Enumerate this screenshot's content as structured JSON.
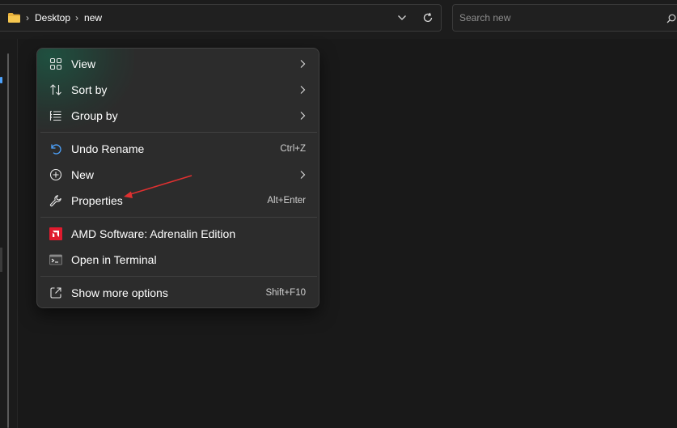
{
  "address_bar": {
    "breadcrumbs": [
      "Desktop",
      "new"
    ],
    "folder_color": "#e8b13c"
  },
  "search": {
    "placeholder": "Search new",
    "value": ""
  },
  "context_menu": {
    "groups": [
      [
        {
          "label": "View",
          "icon": "grid-view-icon",
          "submenu": true
        },
        {
          "label": "Sort by",
          "icon": "sort-arrows-icon",
          "submenu": true
        },
        {
          "label": "Group by",
          "icon": "group-list-icon",
          "submenu": true
        }
      ],
      [
        {
          "label": "Undo Rename",
          "icon": "undo-icon",
          "shortcut": "Ctrl+Z"
        },
        {
          "label": "New",
          "icon": "plus-circle-icon",
          "submenu": true
        },
        {
          "label": "Properties",
          "icon": "wrench-icon",
          "shortcut": "Alt+Enter"
        }
      ],
      [
        {
          "label": "AMD Software: Adrenalin Edition",
          "icon": "amd-logo-icon",
          "icon_color": "#e01b2e"
        },
        {
          "label": "Open in Terminal",
          "icon": "terminal-icon"
        }
      ],
      [
        {
          "label": "Show more options",
          "icon": "share-box-icon",
          "shortcut": "Shift+F10"
        }
      ]
    ]
  },
  "colors": {
    "background": "#191919",
    "menu_background": "#2c2c2c",
    "undo_accent": "#4da3ff",
    "annotation_arrow": "#e03030"
  }
}
